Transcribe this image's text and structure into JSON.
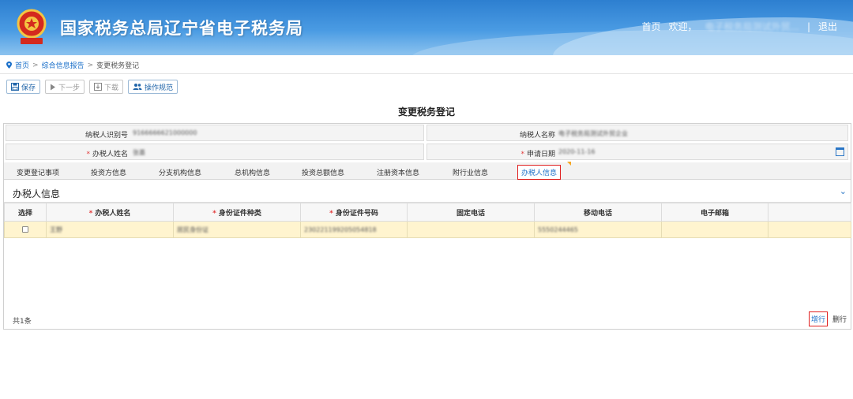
{
  "header": {
    "title": "国家税务总局辽宁省电子税务局",
    "nav_home": "首页",
    "nav_welcome": "欢迎，",
    "nav_user": "电子税务局测试外贸...",
    "nav_sep": "|",
    "nav_logout": "退出"
  },
  "breadcrumb": {
    "home": "首页",
    "sep1": ">",
    "section": "综合信息报告",
    "sep2": ">",
    "current": "变更税务登记"
  },
  "toolbar": {
    "save": "保存",
    "next": "下一步",
    "download": "下载",
    "guide": "操作规范"
  },
  "form": {
    "title": "变更税务登记",
    "taxpayer_id_label": "纳税人识别号",
    "taxpayer_id_value": "9166666621000000",
    "taxpayer_name_label": "纳税人名称",
    "taxpayer_name_value": "电子税务局测试外贸企业",
    "agent_name_label": "办税人姓名",
    "agent_name_value": "张墨",
    "apply_date_label": "申请日期",
    "apply_date_value": "2020-11-16"
  },
  "tabs": [
    "变更登记事项",
    "投资方信息",
    "分支机构信息",
    "总机构信息",
    "投资总额信息",
    "注册资本信息",
    "附行业信息",
    "办税人信息"
  ],
  "section": {
    "title": "办税人信息",
    "chevron": "⌄"
  },
  "table": {
    "headers": [
      "选择",
      "办税人姓名",
      "身份证件种类",
      "身份证件号码",
      "固定电话",
      "移动电话",
      "电子邮箱",
      ""
    ],
    "required": [
      "",
      "*",
      "*",
      "*",
      "",
      "",
      "",
      ""
    ],
    "rows": [
      [
        "",
        "王野",
        "居民身份证",
        "230221199205054818",
        "",
        "5550244465",
        "",
        ""
      ]
    ]
  },
  "footer": {
    "count": "共1条",
    "add_row": "增行",
    "del_row": "删行"
  },
  "icons": {
    "save": "save-icon",
    "next": "play-icon",
    "download": "download-icon",
    "guide": "users-icon"
  }
}
